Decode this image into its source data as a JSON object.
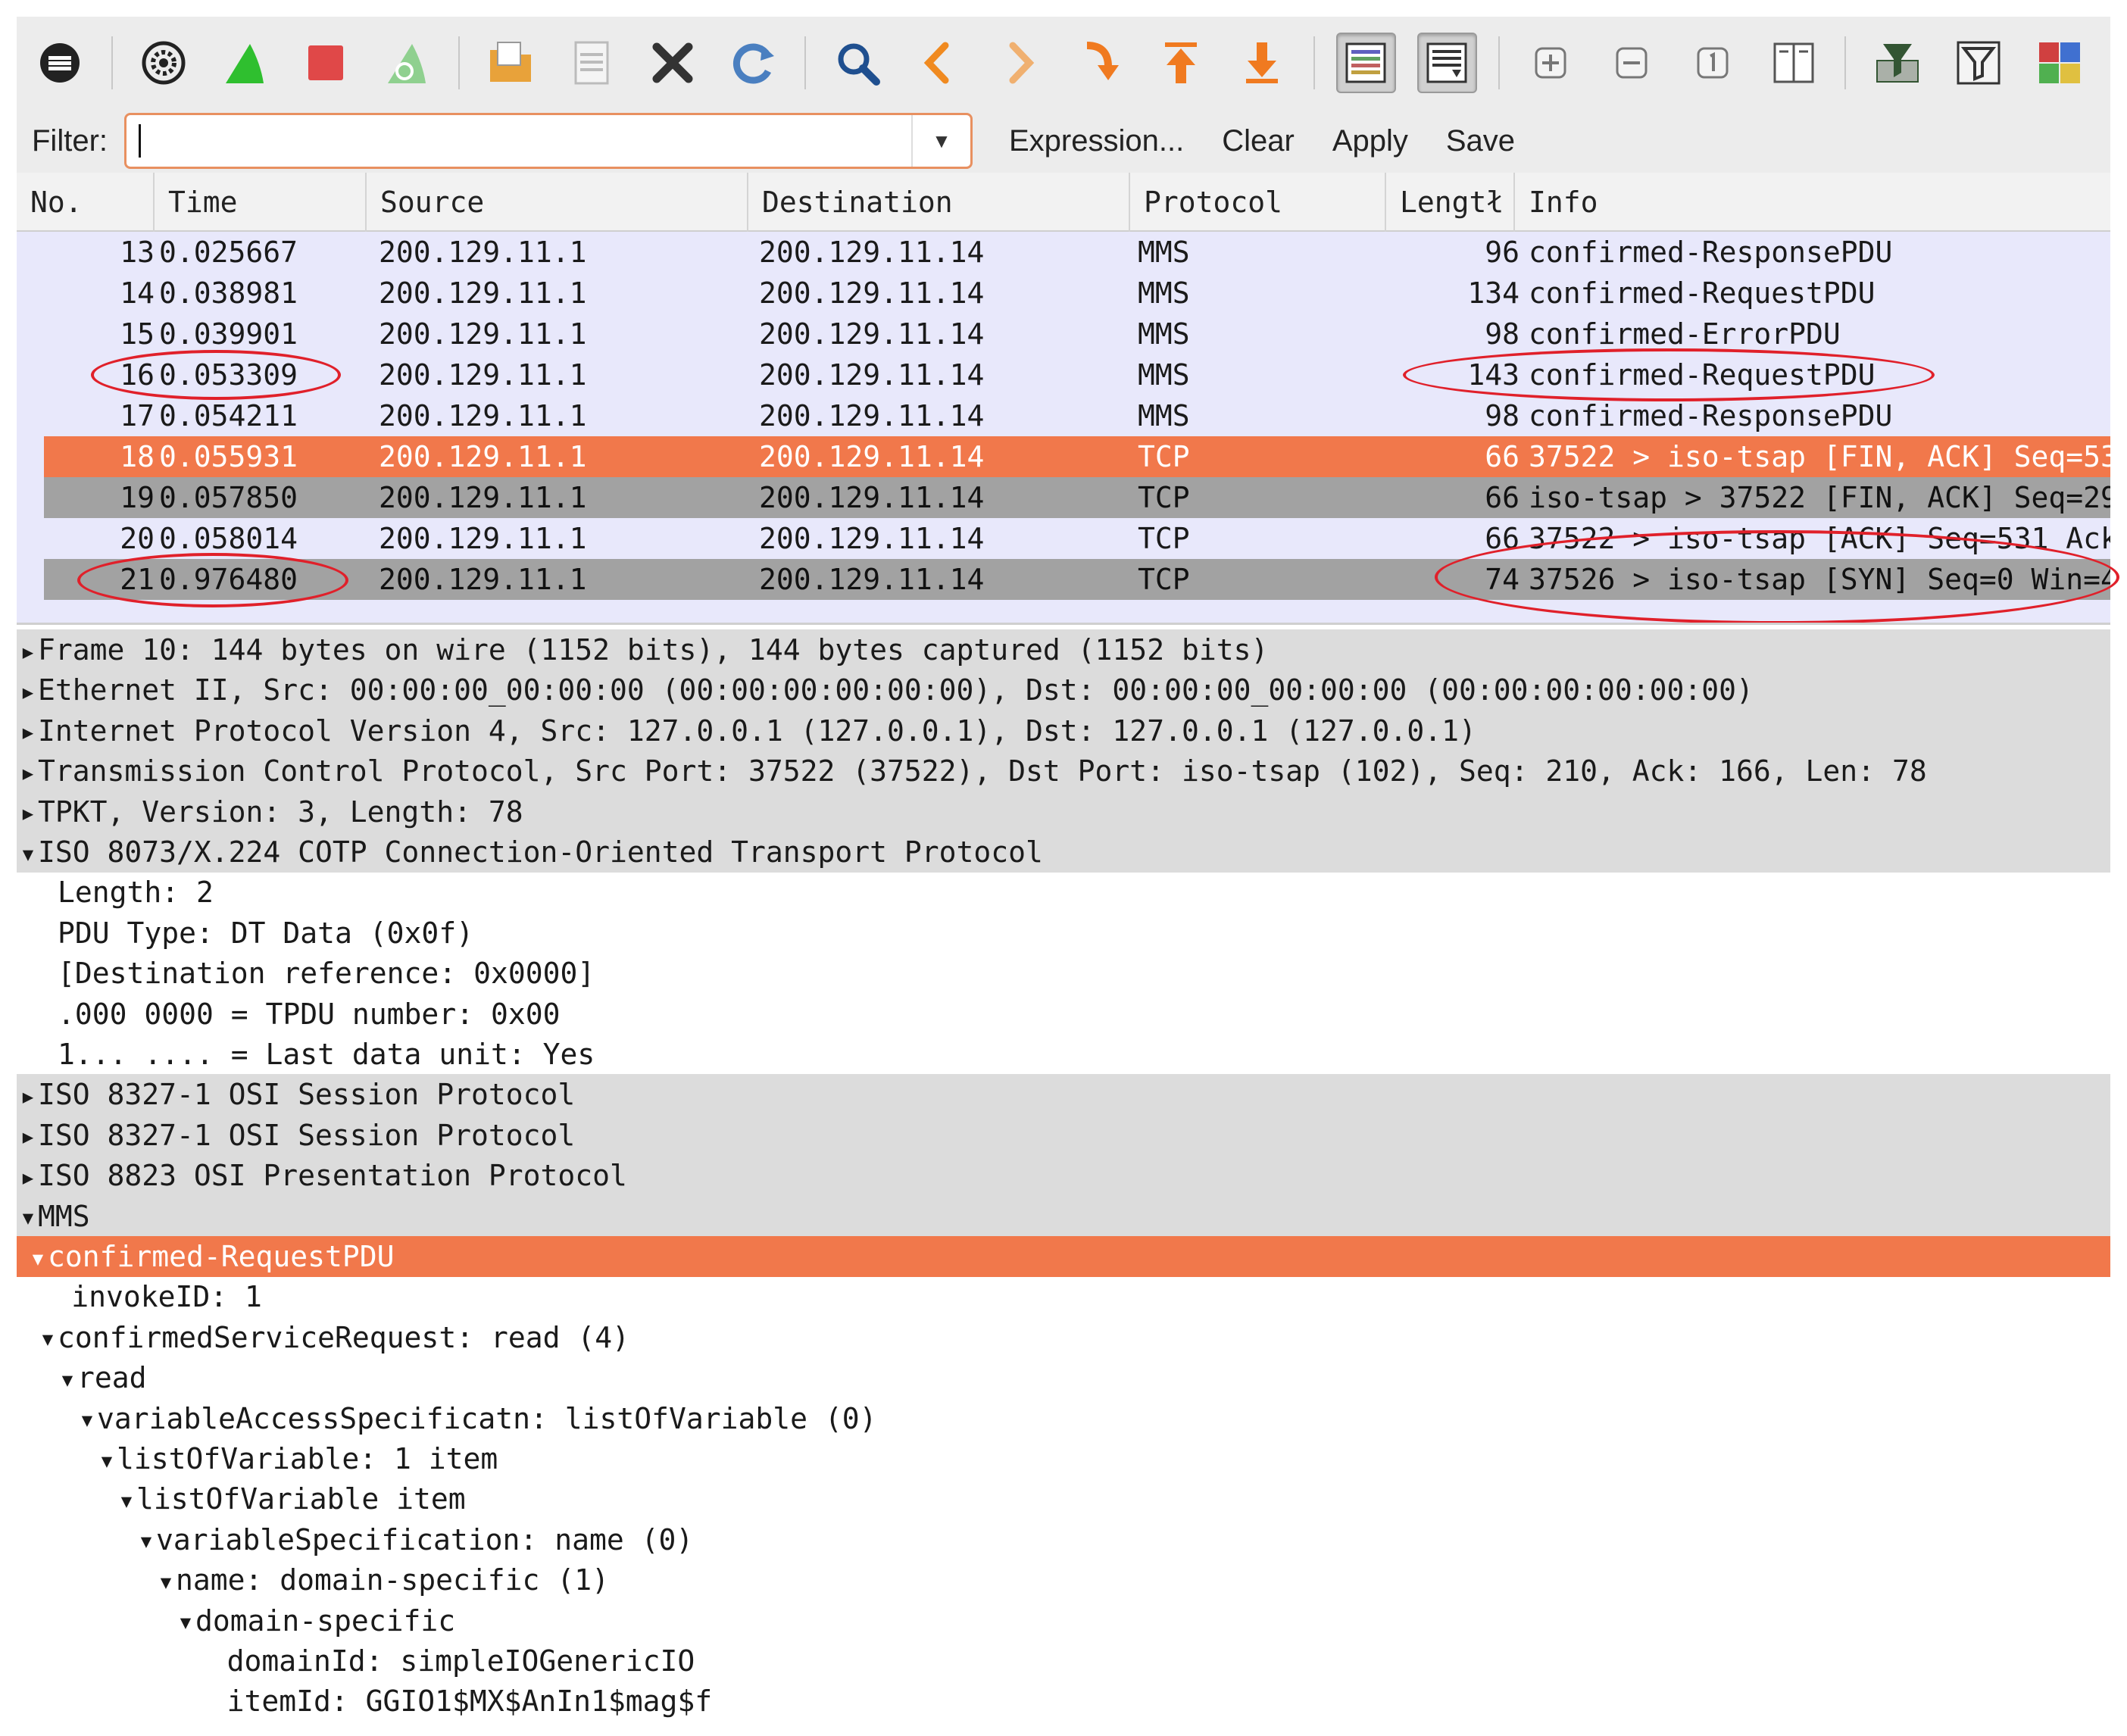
{
  "toolbar": {
    "buttons": [
      {
        "name": "interface-list-icon",
        "color": "#222222"
      },
      {
        "name": "capture-options-icon",
        "color": "#222222"
      },
      {
        "name": "start-capture-fin-icon",
        "color": "#2fbf2f"
      },
      {
        "name": "stop-capture-icon",
        "color": "#e04848"
      },
      {
        "name": "restart-capture-fin-icon",
        "color": "#8fd08f"
      },
      {
        "name": "open-file-folder-icon",
        "color": "#e8a23a"
      },
      {
        "name": "save-file-icon",
        "color": "#bbbbbb"
      },
      {
        "name": "close-file-x-icon",
        "color": "#333333"
      },
      {
        "name": "reload-icon",
        "color": "#4a7fc0"
      },
      {
        "name": "find-packet-magnifier-icon",
        "color": "#1f4f8f"
      },
      {
        "name": "go-back-icon",
        "color": "#f08a20"
      },
      {
        "name": "go-forward-icon",
        "color": "#f0b070"
      },
      {
        "name": "go-to-packet-icon",
        "color": "#f07a20"
      },
      {
        "name": "go-first-packet-icon",
        "color": "#f07a20"
      },
      {
        "name": "go-last-packet-icon",
        "color": "#f07a20"
      },
      {
        "name": "colorize-list-icon",
        "color": "#333333"
      },
      {
        "name": "auto-scroll-icon",
        "color": "#333333"
      },
      {
        "name": "zoom-in-icon",
        "color": "#777777"
      },
      {
        "name": "zoom-out-icon",
        "color": "#777777"
      },
      {
        "name": "normal-size-icon",
        "color": "#777777"
      },
      {
        "name": "resize-columns-icon",
        "color": "#555555"
      },
      {
        "name": "capture-filters-icon",
        "color": "#335533"
      },
      {
        "name": "display-filters-icon",
        "color": "#333333"
      },
      {
        "name": "coloring-rules-icon",
        "color": "#d04040"
      }
    ]
  },
  "filter": {
    "label": "Filter:",
    "value": "",
    "expression": "Expression...",
    "clear": "Clear",
    "apply": "Apply",
    "save": "Save"
  },
  "packet_list": {
    "columns": [
      "No.",
      "Time",
      "Source",
      "Destination",
      "Protocol",
      "Length",
      "Info"
    ],
    "column_header_visible": [
      "No.",
      "Time",
      "Source",
      "Destination",
      "Protocol",
      "Lengtł",
      "Info"
    ],
    "rows": [
      {
        "no": "13",
        "time": "0.025667",
        "src": "200.129.11.1",
        "dst": "200.129.11.14",
        "proto": "MMS",
        "len": "96",
        "info": "confirmed-ResponsePDU",
        "style": "normal"
      },
      {
        "no": "14",
        "time": "0.038981",
        "src": "200.129.11.1",
        "dst": "200.129.11.14",
        "proto": "MMS",
        "len": "134",
        "info": "confirmed-RequestPDU",
        "style": "normal"
      },
      {
        "no": "15",
        "time": "0.039901",
        "src": "200.129.11.1",
        "dst": "200.129.11.14",
        "proto": "MMS",
        "len": "98",
        "info": "confirmed-ErrorPDU",
        "style": "normal"
      },
      {
        "no": "16",
        "time": "0.053309",
        "src": "200.129.11.1",
        "dst": "200.129.11.14",
        "proto": "MMS",
        "len": "143",
        "info": "confirmed-RequestPDU",
        "style": "normal"
      },
      {
        "no": "17",
        "time": "0.054211",
        "src": "200.129.11.1",
        "dst": "200.129.11.14",
        "proto": "MMS",
        "len": "98",
        "info": "confirmed-ResponsePDU",
        "style": "normal"
      },
      {
        "no": "18",
        "time": "0.055931",
        "src": "200.129.11.1",
        "dst": "200.129.11.14",
        "proto": "TCP",
        "len": "66",
        "info": "37522 > iso-tsap [FIN, ACK] Seq=53",
        "style": "orange"
      },
      {
        "no": "19",
        "time": "0.057850",
        "src": "200.129.11.1",
        "dst": "200.129.11.14",
        "proto": "TCP",
        "len": "66",
        "info": "iso-tsap > 37522 [FIN, ACK] Seq=29",
        "style": "gray"
      },
      {
        "no": "20",
        "time": "0.058014",
        "src": "200.129.11.1",
        "dst": "200.129.11.14",
        "proto": "TCP",
        "len": "66",
        "info": "37522 > iso-tsap [ACK] Seq=531 Ack",
        "style": "normal"
      },
      {
        "no": "21",
        "time": "0.976480",
        "src": "200.129.11.1",
        "dst": "200.129.11.14",
        "proto": "TCP",
        "len": "74",
        "info": "37526 > iso-tsap [SYN] Seq=0 Win=4",
        "style": "gray"
      }
    ]
  },
  "details": {
    "rows": [
      {
        "text": "Frame 10: 144 bytes on wire (1152 bits), 144 bytes captured (1152 bits)",
        "indent": 0,
        "arrow": "right",
        "style": "shaded"
      },
      {
        "text": "Ethernet II, Src: 00:00:00_00:00:00 (00:00:00:00:00:00), Dst: 00:00:00_00:00:00 (00:00:00:00:00:00)",
        "indent": 0,
        "arrow": "right",
        "style": "shaded"
      },
      {
        "text": "Internet Protocol Version 4, Src: 127.0.0.1 (127.0.0.1), Dst: 127.0.0.1 (127.0.0.1)",
        "indent": 0,
        "arrow": "right",
        "style": "shaded"
      },
      {
        "text": "Transmission Control Protocol, Src Port: 37522 (37522), Dst Port: iso-tsap (102), Seq: 210, Ack: 166, Len: 78",
        "indent": 0,
        "arrow": "right",
        "style": "shaded"
      },
      {
        "text": "TPKT, Version: 3, Length: 78",
        "indent": 0,
        "arrow": "right",
        "style": "shaded"
      },
      {
        "text": "ISO 8073/X.224 COTP Connection-Oriented Transport Protocol",
        "indent": 0,
        "arrow": "down",
        "style": "shaded"
      },
      {
        "text": "Length: 2",
        "indent": 1,
        "arrow": "none",
        "style": "plain"
      },
      {
        "text": "PDU Type: DT Data (0x0f)",
        "indent": 1,
        "arrow": "none",
        "style": "plain"
      },
      {
        "text": "[Destination reference: 0x0000]",
        "indent": 1,
        "arrow": "none",
        "style": "plain"
      },
      {
        "text": ".000 0000 = TPDU number: 0x00",
        "indent": 1,
        "arrow": "none",
        "style": "plain"
      },
      {
        "text": "1... .... = Last data unit: Yes",
        "indent": 1,
        "arrow": "none",
        "style": "plain"
      },
      {
        "text": "ISO 8327-1 OSI Session Protocol",
        "indent": 0,
        "arrow": "right",
        "style": "shaded"
      },
      {
        "text": "ISO 8327-1 OSI Session Protocol",
        "indent": 0,
        "arrow": "right",
        "style": "shaded"
      },
      {
        "text": "ISO 8823 OSI Presentation Protocol",
        "indent": 0,
        "arrow": "right",
        "style": "shaded"
      },
      {
        "text": "MMS",
        "indent": 0,
        "arrow": "down",
        "style": "shaded"
      },
      {
        "text": "confirmed-RequestPDU",
        "indent": 0.5,
        "arrow": "down",
        "style": "selected"
      },
      {
        "text": "invokeID: 1",
        "indent": 1.7,
        "arrow": "none",
        "style": "plain"
      },
      {
        "text": "confirmedServiceRequest: read (4)",
        "indent": 1,
        "arrow": "down",
        "style": "plain"
      },
      {
        "text": "read",
        "indent": 2,
        "arrow": "down",
        "style": "plain"
      },
      {
        "text": "variableAccessSpecificatn: listOfVariable (0)",
        "indent": 3,
        "arrow": "down",
        "style": "plain"
      },
      {
        "text": "listOfVariable: 1 item",
        "indent": 4,
        "arrow": "down",
        "style": "plain"
      },
      {
        "text": "listOfVariable item",
        "indent": 5,
        "arrow": "down",
        "style": "plain"
      },
      {
        "text": "variableSpecification: name (0)",
        "indent": 6,
        "arrow": "down",
        "style": "plain"
      },
      {
        "text": "name: domain-specific (1)",
        "indent": 7,
        "arrow": "down",
        "style": "plain"
      },
      {
        "text": "domain-specific",
        "indent": 8,
        "arrow": "down",
        "style": "plain"
      },
      {
        "text": "domainId: simpleIOGenericIO",
        "indent": 9.6,
        "arrow": "none",
        "style": "plain"
      },
      {
        "text": "itemId: GGIO1$MX$AnIn1$mag$f",
        "indent": 9.6,
        "arrow": "none",
        "style": "plain"
      }
    ]
  },
  "colors": {
    "selected_row": "#f1784b",
    "gray_row": "#a2a2a2",
    "list_bg": "#e8e8fb",
    "annotation": "#e0202a"
  }
}
